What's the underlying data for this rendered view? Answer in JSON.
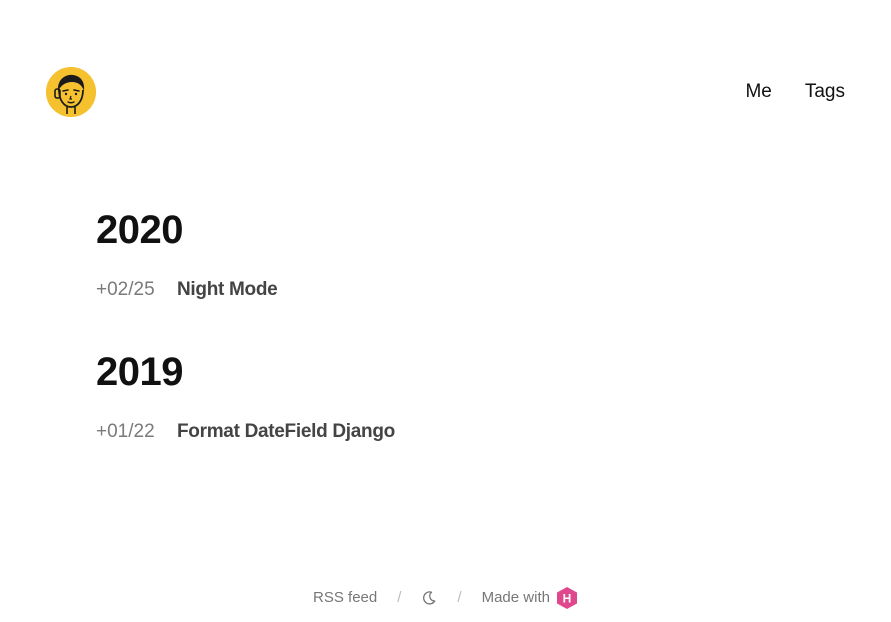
{
  "header": {
    "avatar_alt": "avatar",
    "nav": [
      {
        "label": "Me"
      },
      {
        "label": "Tags"
      }
    ]
  },
  "archive": [
    {
      "year": "2020",
      "posts": [
        {
          "date": "+02/25",
          "title": "Night Mode"
        }
      ]
    },
    {
      "year": "2019",
      "posts": [
        {
          "date": "+01/22",
          "title": "Format DateField Django"
        }
      ]
    }
  ],
  "footer": {
    "rss_label": "RSS feed",
    "separator": "/",
    "made_with_label": "Made with",
    "theme_toggle_icon": "moon-icon",
    "hexo_icon": "hexo-logo-icon",
    "hexo_letter": "H"
  },
  "colors": {
    "avatar_bg": "#f5c12e",
    "hexo_pink": "#e0488d",
    "date_gray": "#7a7a7a",
    "title_gray": "#444444"
  }
}
